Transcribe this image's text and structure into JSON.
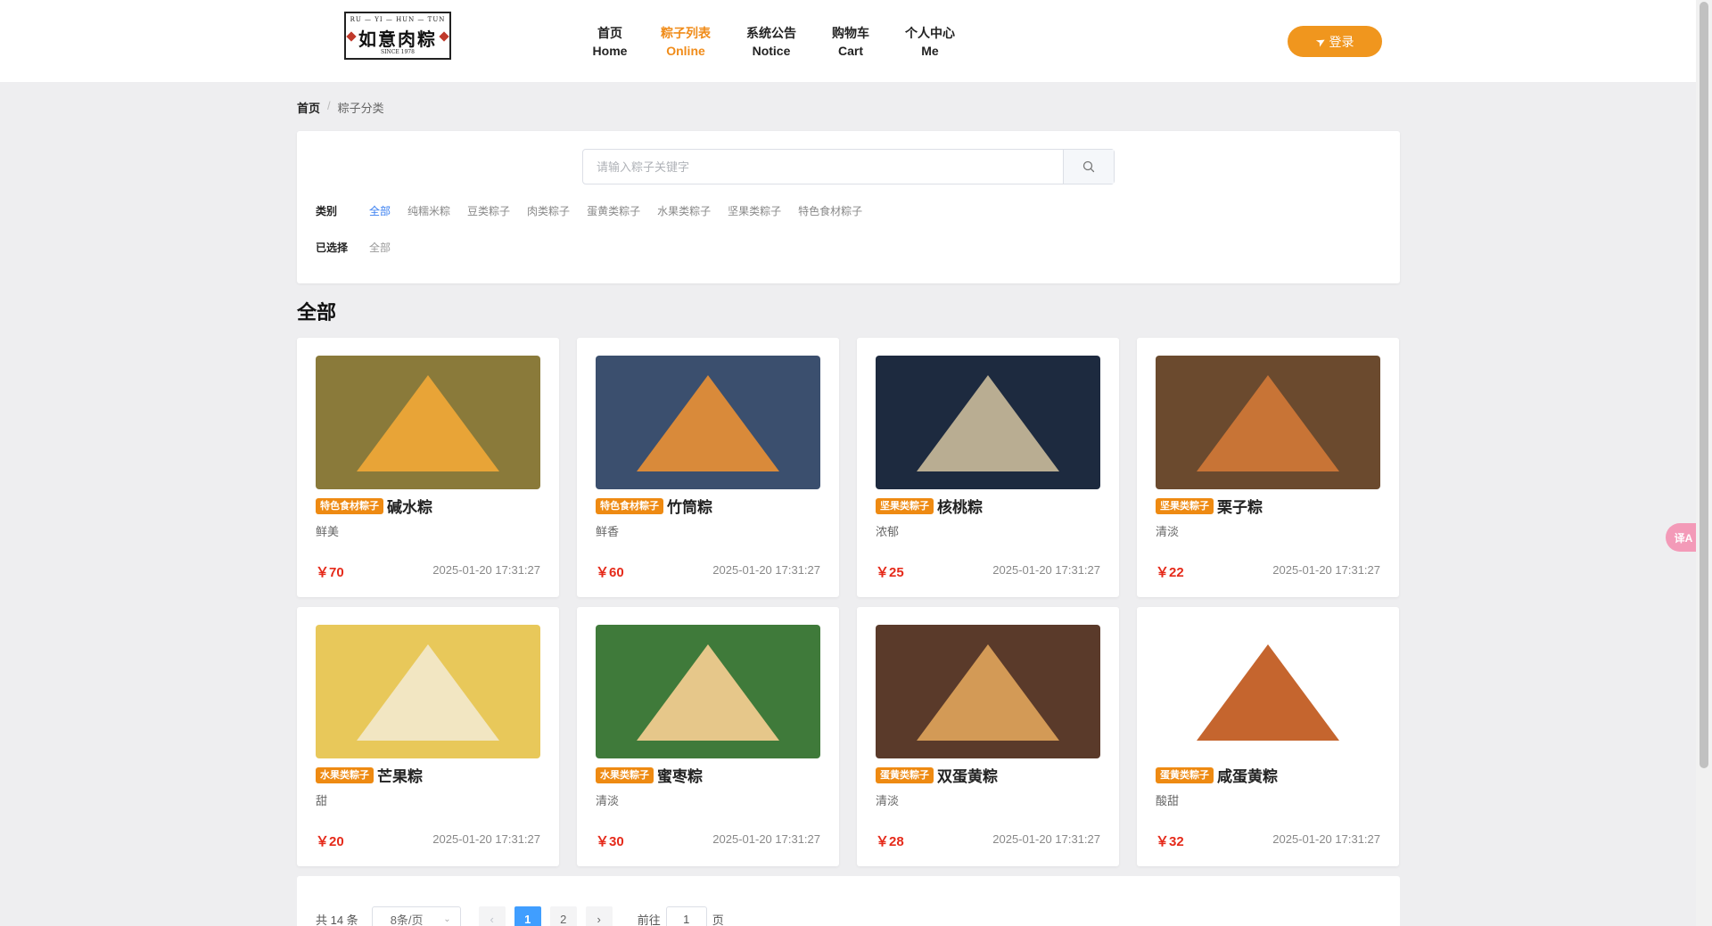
{
  "logo": {
    "top": "RU — YI — HUN — TUN",
    "name": "如意肉粽",
    "since": "SINCE 1978"
  },
  "nav": [
    {
      "zh": "首页",
      "en": "Home",
      "active": false
    },
    {
      "zh": "粽子列表",
      "en": "Online",
      "active": true
    },
    {
      "zh": "系统公告",
      "en": "Notice",
      "active": false
    },
    {
      "zh": "购物车",
      "en": "Cart",
      "active": false
    },
    {
      "zh": "个人中心",
      "en": "Me",
      "active": false
    }
  ],
  "login_label": "登录",
  "breadcrumb": {
    "home": "首页",
    "sep": "/",
    "current": "粽子分类"
  },
  "search": {
    "placeholder": "请输入粽子关键字"
  },
  "filter": {
    "category_label": "类别",
    "categories": [
      "全部",
      "纯糯米粽",
      "豆类粽子",
      "肉类粽子",
      "蛋黄类粽子",
      "水果类粽子",
      "坚果类粽子",
      "特色食材粽子"
    ],
    "selected_label": "已选择",
    "selected_value": "全部"
  },
  "section_title": "全部",
  "products": [
    {
      "tag": "特色食材粽子",
      "name": "碱水粽",
      "desc": "鲜美",
      "price": "￥70",
      "date": "2025-01-20 17:31:27",
      "bg": "#8a7a3a",
      "fg": "#e8a437"
    },
    {
      "tag": "特色食材粽子",
      "name": "竹筒粽",
      "desc": "鲜香",
      "price": "￥60",
      "date": "2025-01-20 17:31:27",
      "bg": "#3b4f6e",
      "fg": "#d98a3a"
    },
    {
      "tag": "坚果类粽子",
      "name": "核桃粽",
      "desc": "浓郁",
      "price": "￥25",
      "date": "2025-01-20 17:31:27",
      "bg": "#1d2a3f",
      "fg": "#b9ad92"
    },
    {
      "tag": "坚果类粽子",
      "name": "栗子粽",
      "desc": "清淡",
      "price": "￥22",
      "date": "2025-01-20 17:31:27",
      "bg": "#6b4a2e",
      "fg": "#c87436"
    },
    {
      "tag": "水果类粽子",
      "name": "芒果粽",
      "desc": "甜",
      "price": "￥20",
      "date": "2025-01-20 17:31:27",
      "bg": "#e8c85a",
      "fg": "#f2e6c2"
    },
    {
      "tag": "水果类粽子",
      "name": "蜜枣粽",
      "desc": "清淡",
      "price": "￥30",
      "date": "2025-01-20 17:31:27",
      "bg": "#3f7a3a",
      "fg": "#e6c78a"
    },
    {
      "tag": "蛋黄类粽子",
      "name": "双蛋黄粽",
      "desc": "清淡",
      "price": "￥28",
      "date": "2025-01-20 17:31:27",
      "bg": "#5a3a2a",
      "fg": "#d39a56"
    },
    {
      "tag": "蛋黄类粽子",
      "name": "咸蛋黄粽",
      "desc": "酸甜",
      "price": "￥32",
      "date": "2025-01-20 17:31:27",
      "bg": "#ffffff",
      "fg": "#c5652e"
    }
  ],
  "pagination": {
    "total": "共 14 条",
    "page_size": "8条/页",
    "pages": [
      "1",
      "2"
    ],
    "current_page": "1",
    "goto_prefix": "前往",
    "goto_value": "1",
    "goto_suffix": "页"
  },
  "translate_label": "译A"
}
